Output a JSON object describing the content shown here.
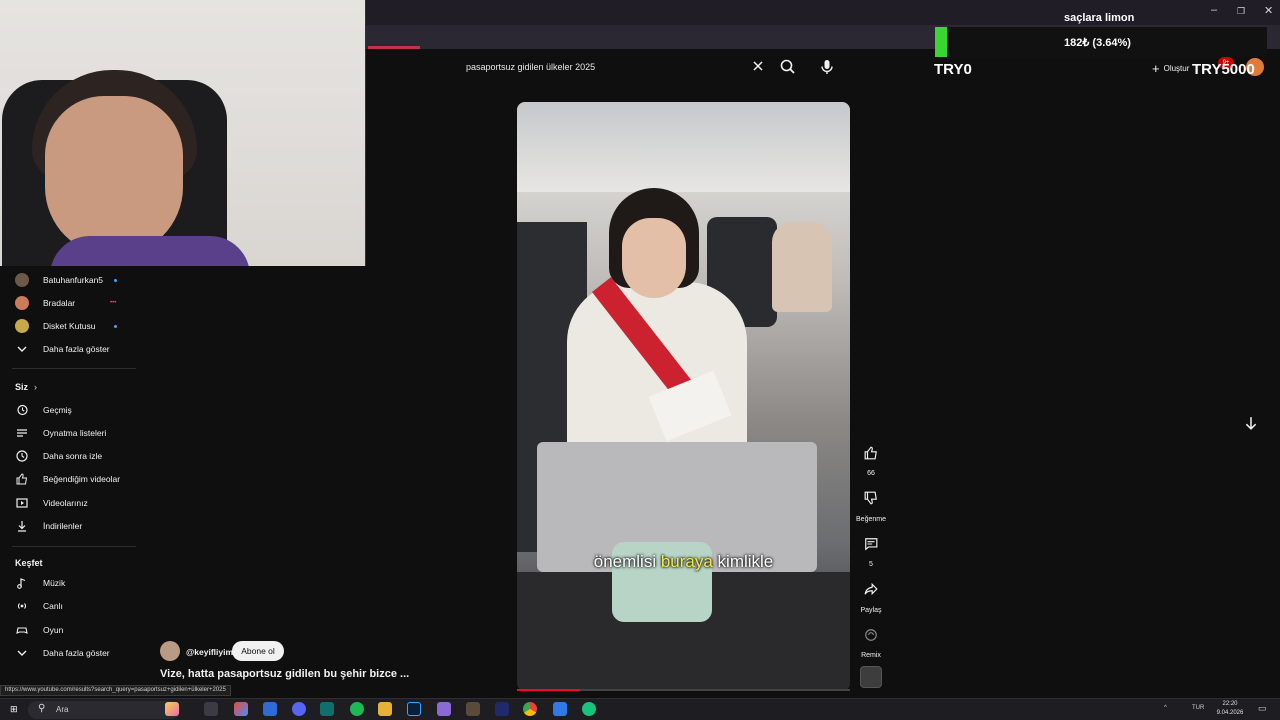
{
  "search": {
    "query": "pasaportsuz gidilen ülkeler 2025"
  },
  "sidebar": {
    "subscriptions": [
      {
        "label": "Batuhanfurkan5",
        "avatar_color": "#6b5a4a",
        "indicator": "dot"
      },
      {
        "label": "Bradalar",
        "avatar_color": "#c97b5a",
        "indicator": "live"
      },
      {
        "label": "Disket Kutusu",
        "avatar_color": "#c9a84a",
        "indicator": "dot"
      }
    ],
    "live_badge": "•••",
    "show_more_1": "Daha fazla göster",
    "you_heading": "Siz",
    "you_items": [
      {
        "label": "Geçmiş",
        "icon": "history-icon"
      },
      {
        "label": "Oynatma listeleri",
        "icon": "playlist-icon"
      },
      {
        "label": "Daha sonra izle",
        "icon": "clock-icon"
      },
      {
        "label": "Beğendiğim videolar",
        "icon": "thumb-up-icon"
      },
      {
        "label": "Videolarınız",
        "icon": "video-icon"
      },
      {
        "label": "İndirilenler",
        "icon": "download-icon"
      }
    ],
    "explore_heading": "Keşfet",
    "explore_items": [
      {
        "label": "Müzik",
        "icon": "music-icon"
      },
      {
        "label": "Canlı",
        "icon": "live-icon"
      },
      {
        "label": "Oyun",
        "icon": "gamepad-icon"
      }
    ],
    "show_more_2": "Daha fazla göster"
  },
  "video": {
    "caption_part1": "önemlisi ",
    "caption_highlight": "buraya",
    "caption_part2": " kimlikle",
    "progress": 0.19
  },
  "channel": {
    "name": "@keyifliyim",
    "subscribe_label": "Abone ol"
  },
  "video_title": "Vize, hatta pasaportsuz gidilen bu şehir bizce ...",
  "status_url": "https://www.youtube.com/results?search_query=pasaportsuz+gidilen+ülkeler+2025",
  "actions": {
    "like_count": "66",
    "dislike_label": "Beğenme",
    "comment_count": "5",
    "share_label": "Paylaş",
    "remix_label": "Remix"
  },
  "overlay": {
    "title": "saçlara limon",
    "value": "182₺ (3.64%)",
    "left_label": "TRY0",
    "right_label": "TRY5000",
    "bar_fill": 0.0364,
    "bar_color": "#38d630"
  },
  "header": {
    "create_label": "Oluştur",
    "notification_count": "9+"
  },
  "window_controls": {
    "minimize": "–",
    "restore": "❐",
    "close": "✕"
  },
  "taskbar": {
    "search_placeholder": "Ara",
    "language": "TUR",
    "time": "22:20",
    "date": "9.04.2026",
    "apps": [
      "copilot",
      "file-explorer",
      "edge",
      "mail",
      "discord",
      "terminal",
      "spotify",
      "photoshop",
      "vscode",
      "minecraft",
      "capcut",
      "chrome",
      "docs",
      "app"
    ]
  },
  "colors": {
    "accent_red": "#ff0033",
    "caption_highlight": "#f6e94a",
    "background": "#0f0f0f"
  }
}
